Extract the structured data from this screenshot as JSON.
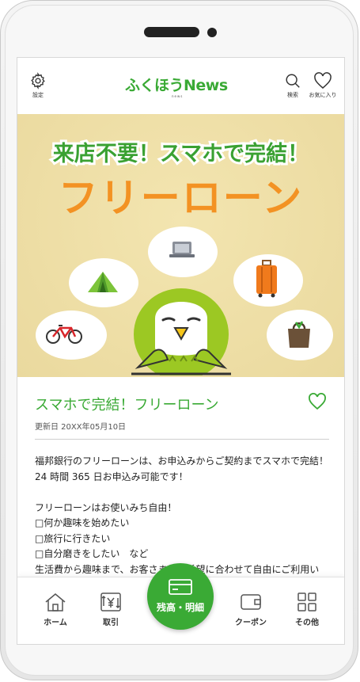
{
  "header": {
    "settings_label": "設定",
    "app_logo": "ふくほうNews",
    "app_logo_sub": "news",
    "search_label": "検索",
    "favorites_label": "お気に入り"
  },
  "banner": {
    "tagline": "来店不要！スマホで完結！",
    "title": "フリーローン"
  },
  "article": {
    "title": "スマホで完結！フリーローン",
    "updated": "更新日 20XX年05月10日",
    "lines": [
      "福邦銀行のフリーローンは、お申込みからご契約までスマホで完結！",
      "24 時間 365 日お申込み可能です！",
      "",
      "フリーローンはお使いみち自由！",
      "□何か趣味を始めたい",
      "□旅行に行きたい",
      "□自分磨きをしたい　など",
      "生活費から趣味まで、お客さまのご希望に合わせて自由にご利用い"
    ]
  },
  "nav": {
    "home": "ホーム",
    "transactions": "取引",
    "balance": "残高・明細",
    "coupon": "クーポン",
    "other": "その他"
  },
  "colors": {
    "brand_green": "#3aaa35",
    "banner_orange": "#f39223",
    "banner_bg": "#eedfa6"
  },
  "icons": [
    "gear-icon",
    "search-icon",
    "heart-icon",
    "home-icon",
    "yen-transfer-icon",
    "card-icon",
    "wallet-icon",
    "grid-icon"
  ]
}
